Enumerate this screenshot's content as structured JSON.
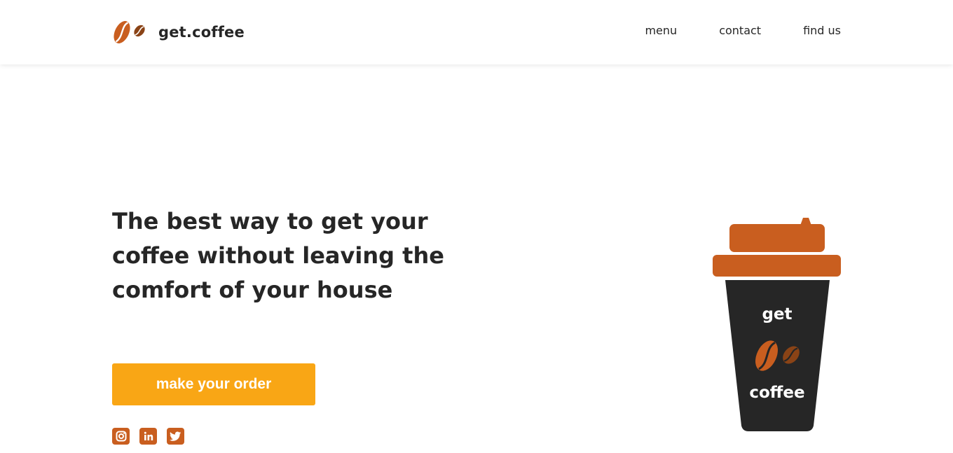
{
  "header": {
    "brand": "get.coffee",
    "nav": [
      {
        "label": "menu"
      },
      {
        "label": "contact"
      },
      {
        "label": "find us"
      }
    ]
  },
  "hero": {
    "headline": "The best way to get your coffee without leaving the comfort of your house",
    "cta_label": "make your order"
  },
  "social": [
    {
      "icon": "instagram-icon"
    },
    {
      "icon": "linkedin-icon"
    },
    {
      "icon": "twitter-icon"
    }
  ],
  "cup": {
    "top_text": "get",
    "bottom_text": "coffee"
  },
  "colors": {
    "accent": "#c95e1f",
    "cta": "#f9a615",
    "text": "#262626",
    "cup_body": "#262626",
    "bean_dark": "#8a4316"
  }
}
